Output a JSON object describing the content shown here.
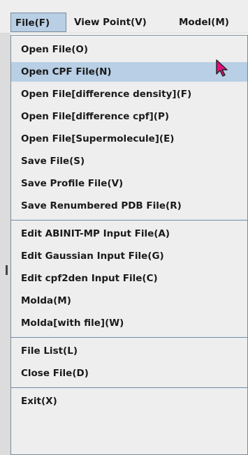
{
  "menubar": {
    "items": [
      "File(F)",
      "View Point(V)",
      "Model(M)"
    ]
  },
  "file_menu": {
    "items": [
      "Open File(O)",
      "Open CPF File(N)",
      "Open File[difference density](F)",
      "Open File[difference cpf](P)",
      "Open File[Supermolecule](E)",
      "Save File(S)",
      "Save Profile File(V)",
      "Save Renumbered PDB File(R)",
      "Edit ABINIT-MP Input File(A)",
      "Edit Gaussian Input File(G)",
      "Edit cpf2den Input File(C)",
      "Molda(M)",
      "Molda[with file](W)",
      "File List(L)",
      "Close File(D)",
      "Exit(X)"
    ],
    "highlighted_item": "Open CPF File(N)"
  },
  "colors": {
    "menu_bg": "#eeeeee",
    "highlight": "#b8cfe5",
    "separator": "#6f8aa8",
    "cursor": "#e0107a"
  },
  "icons": {
    "cursor": "mouse-pointer-icon"
  }
}
